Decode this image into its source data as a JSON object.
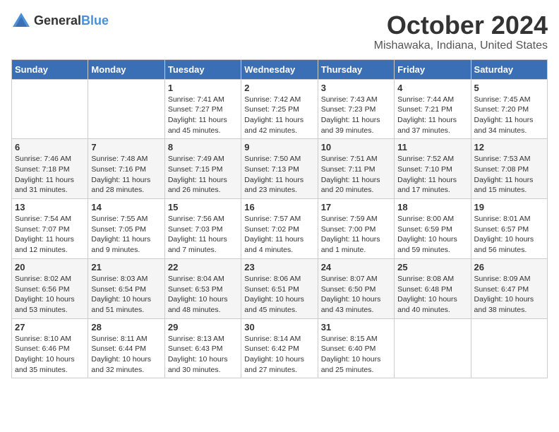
{
  "logo": {
    "general": "General",
    "blue": "Blue"
  },
  "title": "October 2024",
  "location": "Mishawaka, Indiana, United States",
  "weekdays": [
    "Sunday",
    "Monday",
    "Tuesday",
    "Wednesday",
    "Thursday",
    "Friday",
    "Saturday"
  ],
  "weeks": [
    [
      {
        "day": "",
        "sunrise": "",
        "sunset": "",
        "daylight": ""
      },
      {
        "day": "",
        "sunrise": "",
        "sunset": "",
        "daylight": ""
      },
      {
        "day": "1",
        "sunrise": "Sunrise: 7:41 AM",
        "sunset": "Sunset: 7:27 PM",
        "daylight": "Daylight: 11 hours and 45 minutes."
      },
      {
        "day": "2",
        "sunrise": "Sunrise: 7:42 AM",
        "sunset": "Sunset: 7:25 PM",
        "daylight": "Daylight: 11 hours and 42 minutes."
      },
      {
        "day": "3",
        "sunrise": "Sunrise: 7:43 AM",
        "sunset": "Sunset: 7:23 PM",
        "daylight": "Daylight: 11 hours and 39 minutes."
      },
      {
        "day": "4",
        "sunrise": "Sunrise: 7:44 AM",
        "sunset": "Sunset: 7:21 PM",
        "daylight": "Daylight: 11 hours and 37 minutes."
      },
      {
        "day": "5",
        "sunrise": "Sunrise: 7:45 AM",
        "sunset": "Sunset: 7:20 PM",
        "daylight": "Daylight: 11 hours and 34 minutes."
      }
    ],
    [
      {
        "day": "6",
        "sunrise": "Sunrise: 7:46 AM",
        "sunset": "Sunset: 7:18 PM",
        "daylight": "Daylight: 11 hours and 31 minutes."
      },
      {
        "day": "7",
        "sunrise": "Sunrise: 7:48 AM",
        "sunset": "Sunset: 7:16 PM",
        "daylight": "Daylight: 11 hours and 28 minutes."
      },
      {
        "day": "8",
        "sunrise": "Sunrise: 7:49 AM",
        "sunset": "Sunset: 7:15 PM",
        "daylight": "Daylight: 11 hours and 26 minutes."
      },
      {
        "day": "9",
        "sunrise": "Sunrise: 7:50 AM",
        "sunset": "Sunset: 7:13 PM",
        "daylight": "Daylight: 11 hours and 23 minutes."
      },
      {
        "day": "10",
        "sunrise": "Sunrise: 7:51 AM",
        "sunset": "Sunset: 7:11 PM",
        "daylight": "Daylight: 11 hours and 20 minutes."
      },
      {
        "day": "11",
        "sunrise": "Sunrise: 7:52 AM",
        "sunset": "Sunset: 7:10 PM",
        "daylight": "Daylight: 11 hours and 17 minutes."
      },
      {
        "day": "12",
        "sunrise": "Sunrise: 7:53 AM",
        "sunset": "Sunset: 7:08 PM",
        "daylight": "Daylight: 11 hours and 15 minutes."
      }
    ],
    [
      {
        "day": "13",
        "sunrise": "Sunrise: 7:54 AM",
        "sunset": "Sunset: 7:07 PM",
        "daylight": "Daylight: 11 hours and 12 minutes."
      },
      {
        "day": "14",
        "sunrise": "Sunrise: 7:55 AM",
        "sunset": "Sunset: 7:05 PM",
        "daylight": "Daylight: 11 hours and 9 minutes."
      },
      {
        "day": "15",
        "sunrise": "Sunrise: 7:56 AM",
        "sunset": "Sunset: 7:03 PM",
        "daylight": "Daylight: 11 hours and 7 minutes."
      },
      {
        "day": "16",
        "sunrise": "Sunrise: 7:57 AM",
        "sunset": "Sunset: 7:02 PM",
        "daylight": "Daylight: 11 hours and 4 minutes."
      },
      {
        "day": "17",
        "sunrise": "Sunrise: 7:59 AM",
        "sunset": "Sunset: 7:00 PM",
        "daylight": "Daylight: 11 hours and 1 minute."
      },
      {
        "day": "18",
        "sunrise": "Sunrise: 8:00 AM",
        "sunset": "Sunset: 6:59 PM",
        "daylight": "Daylight: 10 hours and 59 minutes."
      },
      {
        "day": "19",
        "sunrise": "Sunrise: 8:01 AM",
        "sunset": "Sunset: 6:57 PM",
        "daylight": "Daylight: 10 hours and 56 minutes."
      }
    ],
    [
      {
        "day": "20",
        "sunrise": "Sunrise: 8:02 AM",
        "sunset": "Sunset: 6:56 PM",
        "daylight": "Daylight: 10 hours and 53 minutes."
      },
      {
        "day": "21",
        "sunrise": "Sunrise: 8:03 AM",
        "sunset": "Sunset: 6:54 PM",
        "daylight": "Daylight: 10 hours and 51 minutes."
      },
      {
        "day": "22",
        "sunrise": "Sunrise: 8:04 AM",
        "sunset": "Sunset: 6:53 PM",
        "daylight": "Daylight: 10 hours and 48 minutes."
      },
      {
        "day": "23",
        "sunrise": "Sunrise: 8:06 AM",
        "sunset": "Sunset: 6:51 PM",
        "daylight": "Daylight: 10 hours and 45 minutes."
      },
      {
        "day": "24",
        "sunrise": "Sunrise: 8:07 AM",
        "sunset": "Sunset: 6:50 PM",
        "daylight": "Daylight: 10 hours and 43 minutes."
      },
      {
        "day": "25",
        "sunrise": "Sunrise: 8:08 AM",
        "sunset": "Sunset: 6:48 PM",
        "daylight": "Daylight: 10 hours and 40 minutes."
      },
      {
        "day": "26",
        "sunrise": "Sunrise: 8:09 AM",
        "sunset": "Sunset: 6:47 PM",
        "daylight": "Daylight: 10 hours and 38 minutes."
      }
    ],
    [
      {
        "day": "27",
        "sunrise": "Sunrise: 8:10 AM",
        "sunset": "Sunset: 6:46 PM",
        "daylight": "Daylight: 10 hours and 35 minutes."
      },
      {
        "day": "28",
        "sunrise": "Sunrise: 8:11 AM",
        "sunset": "Sunset: 6:44 PM",
        "daylight": "Daylight: 10 hours and 32 minutes."
      },
      {
        "day": "29",
        "sunrise": "Sunrise: 8:13 AM",
        "sunset": "Sunset: 6:43 PM",
        "daylight": "Daylight: 10 hours and 30 minutes."
      },
      {
        "day": "30",
        "sunrise": "Sunrise: 8:14 AM",
        "sunset": "Sunset: 6:42 PM",
        "daylight": "Daylight: 10 hours and 27 minutes."
      },
      {
        "day": "31",
        "sunrise": "Sunrise: 8:15 AM",
        "sunset": "Sunset: 6:40 PM",
        "daylight": "Daylight: 10 hours and 25 minutes."
      },
      {
        "day": "",
        "sunrise": "",
        "sunset": "",
        "daylight": ""
      },
      {
        "day": "",
        "sunrise": "",
        "sunset": "",
        "daylight": ""
      }
    ]
  ]
}
